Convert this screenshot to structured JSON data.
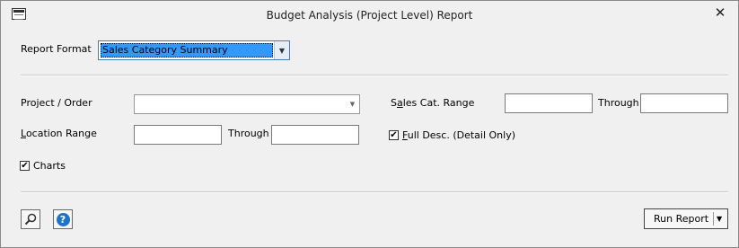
{
  "window": {
    "title": "Budget Analysis (Project Level) Report",
    "close_glyph": "✕"
  },
  "report_format": {
    "label": "Report Format",
    "selected": "Sales Category Summary"
  },
  "project_order": {
    "label": "Project / Order",
    "value": ""
  },
  "sales_cat_range": {
    "label_pre": "S",
    "label_u": "a",
    "label_post": "les Cat. Range",
    "from": "",
    "through_label": "Through",
    "to": ""
  },
  "location_range": {
    "label_u": "L",
    "label_post": "ocation Range",
    "from": "",
    "through_label": "Through",
    "to": ""
  },
  "full_desc": {
    "label_u": "F",
    "label_post": "ull Desc. (Detail Only)",
    "checked": true
  },
  "charts": {
    "label": "Charts",
    "checked": true
  },
  "footer": {
    "run_report_label": "Run Report",
    "help_glyph": "?"
  },
  "icons": [
    "app-window-icon",
    "close-icon",
    "chevron-down-icon",
    "search-icon",
    "help-icon"
  ],
  "colors": {
    "background": "#f0f0f0",
    "selection": "#3399ff",
    "help_blue": "#1e73c8"
  }
}
